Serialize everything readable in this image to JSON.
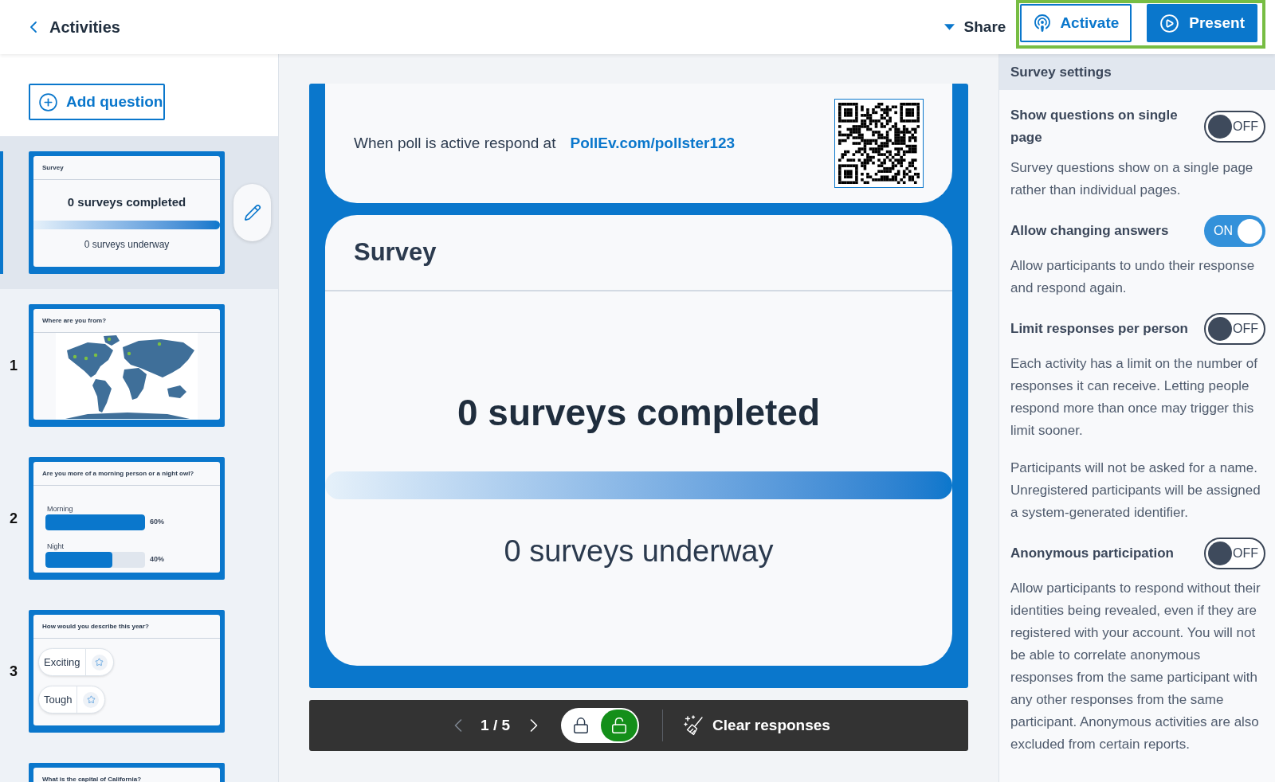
{
  "topbar": {
    "back_label": "Activities",
    "share_label": "Share",
    "actions": {
      "highlighted": true,
      "buttons": [
        {
          "kind": "activate",
          "label": "Activate"
        },
        {
          "kind": "present",
          "label": "Present"
        }
      ]
    }
  },
  "sidebar": {
    "add_button": "Add question",
    "items": [
      {
        "kind": "survey",
        "selected": true,
        "title": "Survey",
        "completed": "0 surveys completed",
        "underway": "0 surveys underway"
      },
      {
        "kind": "map",
        "selected": false,
        "number": "1",
        "title": "Where are you from?"
      },
      {
        "kind": "bars",
        "selected": false,
        "number": "2",
        "title": "Are you more of a morning person or a night owl?",
        "options": [
          {
            "label": "Morning",
            "level": 1,
            "percent": "60%"
          },
          {
            "label": "Night",
            "level": 0.67,
            "percent": "40%"
          }
        ]
      },
      {
        "kind": "words",
        "selected": false,
        "number": "3",
        "title": "How would you describe this year?",
        "words": [
          "Exciting",
          "Tough"
        ]
      },
      {
        "kind": "text",
        "selected": false,
        "title": "What is the capital of California?"
      }
    ]
  },
  "poll": {
    "respond_text": "When poll is active respond at",
    "respond_link": "PollEv.com/pollster123",
    "title": "Survey",
    "completed": "0 surveys completed",
    "underway": "0 surveys underway"
  },
  "toolbar": {
    "page": "1 / 5",
    "prev_disabled": true,
    "next_disabled": false,
    "lock_options": [
      {
        "kind": "locked",
        "selected": false
      },
      {
        "kind": "unlocked",
        "selected": true
      }
    ],
    "clear_label": "Clear responses"
  },
  "settings": {
    "title": "Survey settings",
    "items": [
      {
        "label": "Show questions on single page",
        "on": false,
        "state_label": "OFF",
        "description": [
          "Survey questions show on a single page rather than individual pages."
        ]
      },
      {
        "label": "Allow changing answers",
        "on": true,
        "state_label": "ON",
        "description": [
          "Allow participants to undo their response and respond again."
        ]
      },
      {
        "label": "Limit responses per person",
        "on": false,
        "state_label": "OFF",
        "description": [
          "Each activity has a limit on the number of responses it can receive. Letting people respond more than once may trigger this limit sooner.",
          "Participants will not be asked for a name. Unregistered participants will be assigned a system-generated identifier."
        ]
      },
      {
        "label": "Anonymous participation",
        "on": false,
        "state_label": "OFF",
        "description": [
          "Allow participants to respond without their identities being revealed, even if they are registered with your account. You will not be able to correlate anonymous responses from the same participant with any other responses from the same participant. Anonymous activities are also excluded from certain reports."
        ]
      }
    ]
  }
}
